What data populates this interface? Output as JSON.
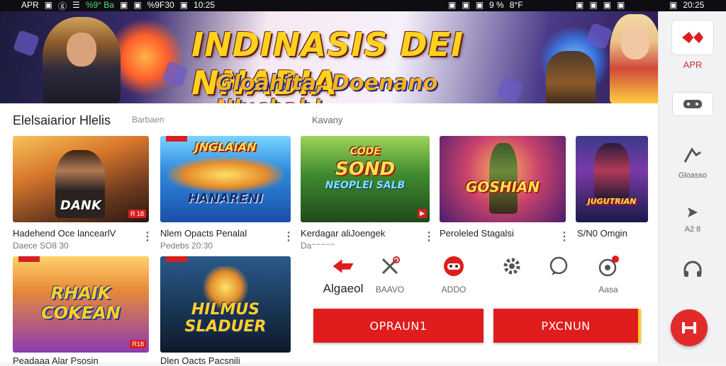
{
  "status_bar": {
    "left": [
      "APR",
      "▣",
      "ⓖ",
      "☰",
      "%9° Ba",
      "▣",
      "▣",
      "%9F30",
      "▣",
      "10:25"
    ],
    "middle": [
      "▣",
      "▣",
      "▣",
      "9 %",
      "8°F"
    ],
    "right": [
      "▣",
      "▣",
      "▣",
      "▣"
    ],
    "far_right": [
      "▣",
      "20:25"
    ]
  },
  "banner": {
    "title": "INDINASIS DEI NNABIA",
    "subtitle": "Gloahita, Doenano Nluchah!"
  },
  "section": {
    "title": "Elelsaiarior Hlelis",
    "subtitle": "Barbaen",
    "tab": "Kavany"
  },
  "cards": [
    {
      "art_text": "DANK",
      "title": "Hadehend Oce lancearlV",
      "meta": "Daece   SO8 30",
      "badge": "R 18"
    },
    {
      "art_text": "HANARENI",
      "title": "Nlem Opacts Penalal",
      "meta": "Pedebs 20:30",
      "badge": ""
    },
    {
      "art_text": "SOND",
      "title": "Kerdagar aliJoengek",
      "meta": "Daeeaos",
      "badge": ""
    },
    {
      "art_text": "GOSHIAN",
      "title": "Peroleled Stagalsi",
      "meta": "",
      "badge": ""
    },
    {
      "art_text": "JUGUTRIAN",
      "title": "S/N0 Omgin",
      "meta": "",
      "badge": ""
    },
    {
      "art_text": "RHAIK COKEAN",
      "title": "Peadaaa Alar Psosin",
      "meta": "",
      "badge": "R18"
    },
    {
      "art_text": "HILMUS SLADUER",
      "title": "Dlen Oacts Pacsnili",
      "meta": "",
      "badge": ""
    }
  ],
  "actions": [
    {
      "label": "Algaeol",
      "icon": "red-arrow-icon"
    },
    {
      "label": "BAAVO",
      "icon": "tools-icon"
    },
    {
      "label": "ADDO",
      "icon": "controller-icon"
    },
    {
      "label": "",
      "icon": "gear-icon"
    },
    {
      "label": "",
      "icon": "chat-icon"
    },
    {
      "label": "Aasa",
      "icon": "notification-icon"
    }
  ],
  "buttons": {
    "primary": "OPRAUN1",
    "secondary": "PXCNUN"
  },
  "sidebar": {
    "items": [
      {
        "label": "APR",
        "icon": "app-logo-icon"
      },
      {
        "label": "",
        "icon": "gamepad-icon"
      },
      {
        "label": "Gloasso",
        "icon": "share-icon"
      },
      {
        "label": "A2 8",
        "icon": "send-icon"
      },
      {
        "label": "",
        "icon": "headset-icon"
      }
    ]
  },
  "colors": {
    "accent": "#e01c1c",
    "banner_title": "#ffd21f"
  }
}
